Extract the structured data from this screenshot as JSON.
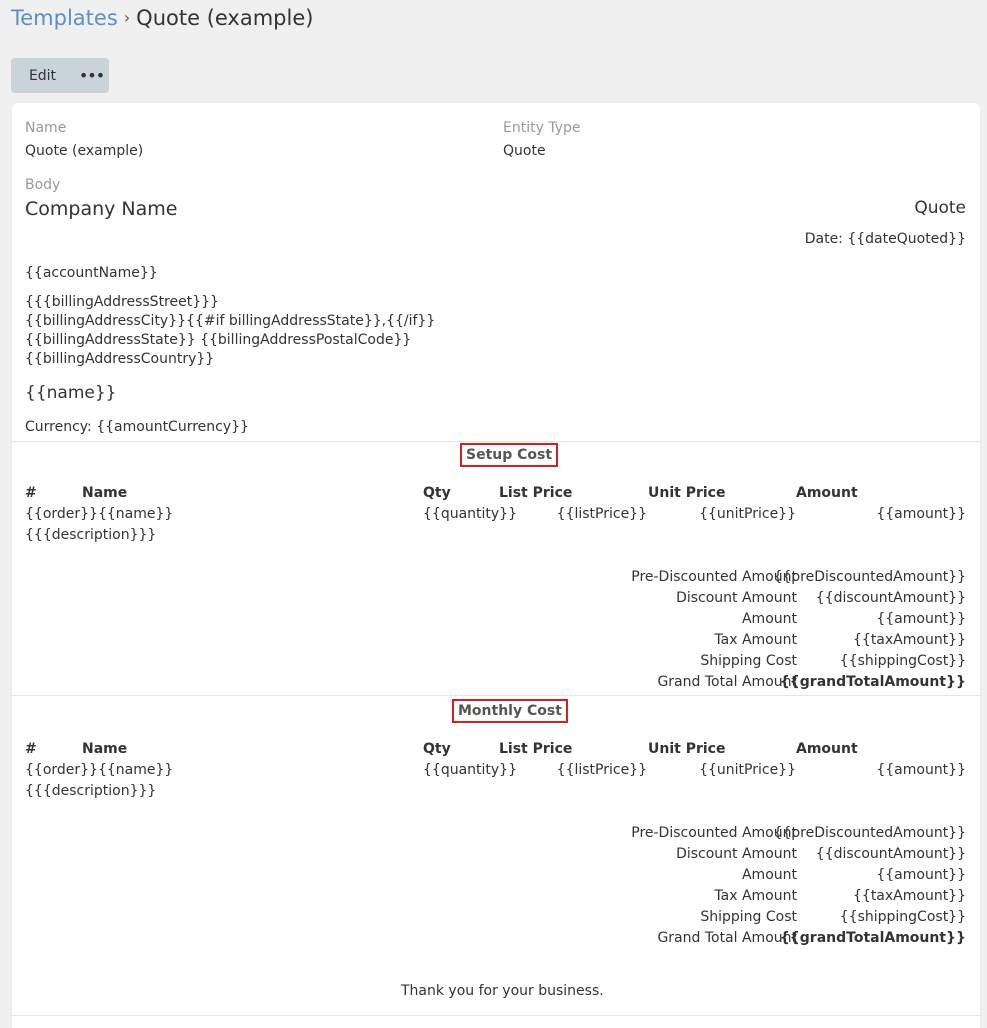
{
  "breadcrumb": {
    "parent": "Templates",
    "separator": "›",
    "current": "Quote (example)"
  },
  "toolbar": {
    "edit_label": "Edit",
    "more_label": "•••"
  },
  "fields": {
    "name_label": "Name",
    "name_value": "Quote (example)",
    "entity_label": "Entity Type",
    "entity_value": "Quote",
    "body_label": "Body"
  },
  "doc": {
    "company": "Company Name",
    "doc_title": "Quote",
    "date_line": "Date: {{dateQuoted}}",
    "account": "{{accountName}}",
    "address": [
      "{{{billingAddressStreet}}}",
      "{{billingAddressCity}}{{#if billingAddressState}},{{/if}}",
      "{{billingAddressState}} {{billingAddressPostalCode}}",
      "{{billingAddressCountry}}"
    ],
    "name_tpl": "{{name}}",
    "currency": "Currency: {{amountCurrency}}",
    "sections": [
      {
        "title": "Setup Cost",
        "cols": [
          "#",
          "Name",
          "Qty",
          "List Price",
          "Unit Price",
          "Amount"
        ],
        "row": {
          "order_name": "{{order}}{{name}}",
          "qty": "{{quantity}}",
          "list": "{{listPrice}}",
          "unit": "{{unitPrice}}",
          "amount": "{{amount}}",
          "desc": "{{{description}}}"
        },
        "totals": [
          {
            "label": "Pre-Discounted Amount",
            "value": "{{preDiscountedAmount}}"
          },
          {
            "label": "Discount Amount",
            "value": "{{discountAmount}}"
          },
          {
            "label": "Amount",
            "value": "{{amount}}"
          },
          {
            "label": "Tax Amount",
            "value": "{{taxAmount}}"
          },
          {
            "label": "Shipping Cost",
            "value": "{{shippingCost}}"
          },
          {
            "label": "Grand Total Amount",
            "value": "{{grandTotalAmount}}"
          }
        ]
      },
      {
        "title": "Monthly Cost",
        "cols": [
          "#",
          "Name",
          "Qty",
          "List Price",
          "Unit Price",
          "Amount"
        ],
        "row": {
          "order_name": "{{order}}{{name}}",
          "qty": "{{quantity}}",
          "list": "{{listPrice}}",
          "unit": "{{unitPrice}}",
          "amount": "{{amount}}",
          "desc": "{{{description}}}"
        },
        "totals": [
          {
            "label": "Pre-Discounted Amount",
            "value": "{{preDiscountedAmount}}"
          },
          {
            "label": "Discount Amount",
            "value": "{{discountAmount}}"
          },
          {
            "label": "Amount",
            "value": "{{amount}}"
          },
          {
            "label": "Tax Amount",
            "value": "{{taxAmount}}"
          },
          {
            "label": "Shipping Cost",
            "value": "{{shippingCost}}"
          },
          {
            "label": "Grand Total Amount",
            "value": "{{grandTotalAmount}}"
          }
        ]
      }
    ],
    "thanks": "Thank you for your business."
  }
}
